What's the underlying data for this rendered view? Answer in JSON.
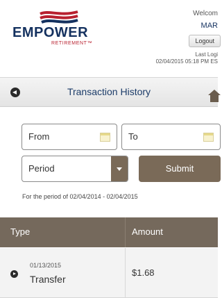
{
  "brand": {
    "name": "EMPOWER",
    "tagline": "RETIREMENT™",
    "colors": {
      "navy": "#14315f",
      "red": "#b8202f"
    }
  },
  "header": {
    "welcome": "Welcom",
    "username": "MAR",
    "logout_label": "Logout",
    "last_login_label": "Last Logi",
    "last_login_value": "02/04/2015 05:18 PM ES"
  },
  "titlebar": {
    "title": "Transaction History",
    "back_icon": "back-arrow-icon",
    "home_icon": "home-icon"
  },
  "filters": {
    "from_label": "From",
    "to_label": "To",
    "period_label": "Period",
    "submit_label": "Submit",
    "period_text": "For the period of 02/04/2014 - 02/04/2015",
    "accent_color": "#7a6a58"
  },
  "table": {
    "columns": [
      "Type",
      "Amount"
    ],
    "header_color": "#75695c",
    "rows": [
      {
        "date": "01/13/2015",
        "type": "Transfer",
        "amount": "$1.68"
      }
    ]
  }
}
